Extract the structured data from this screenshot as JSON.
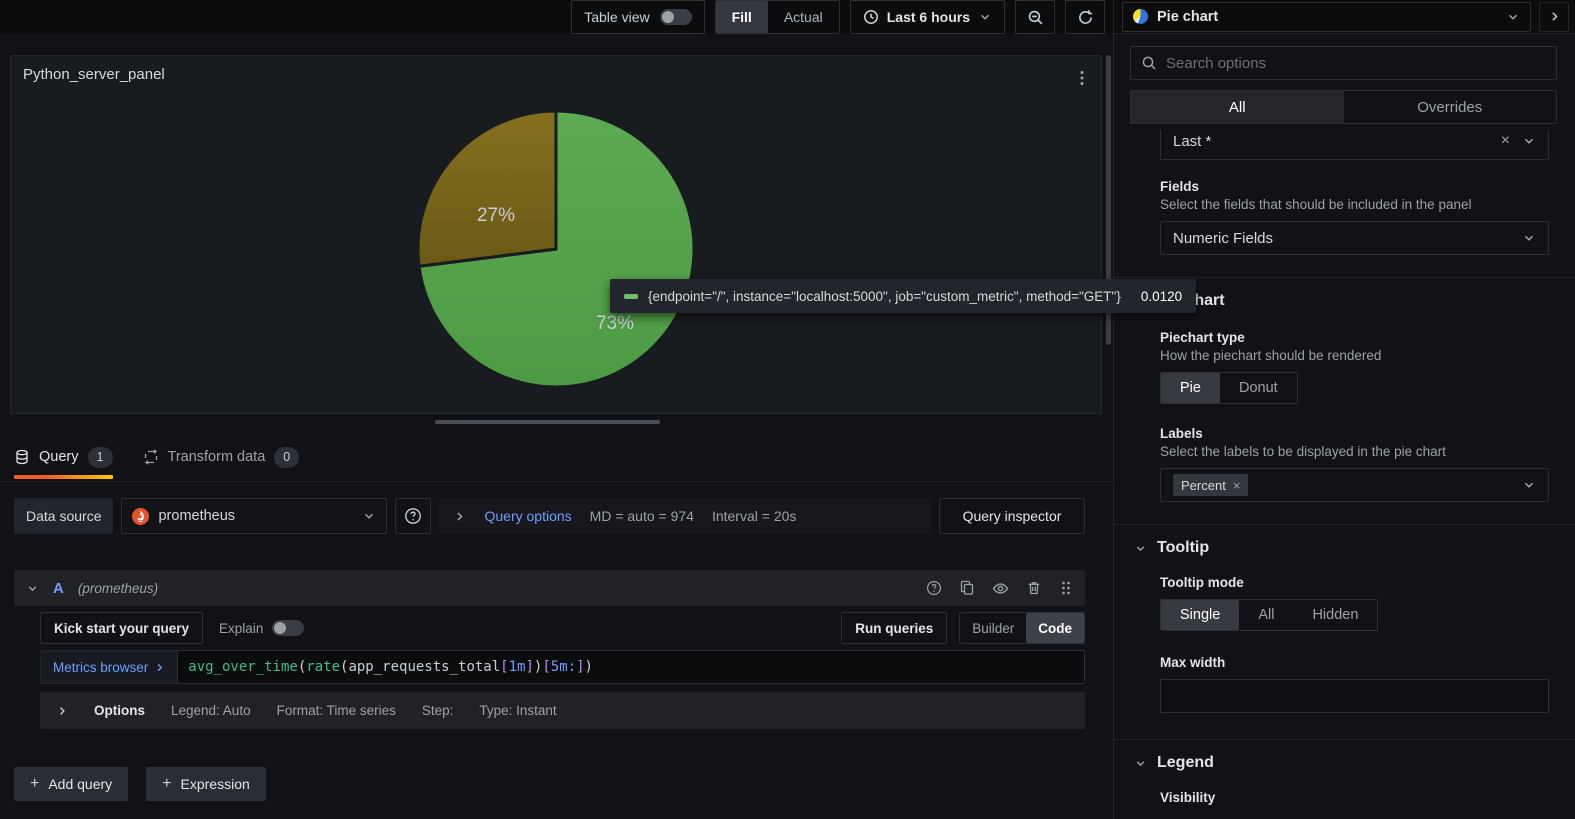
{
  "topbar": {
    "table_view_label": "Table view",
    "fill_label": "Fill",
    "actual_label": "Actual",
    "time_range_label": "Last 6 hours"
  },
  "panel": {
    "title": "Python_server_panel"
  },
  "chart_data": {
    "type": "pie",
    "title": "Python_server_panel",
    "slices": [
      {
        "label": "73%",
        "value": 73,
        "color": "#56a64b",
        "series": "{endpoint=\"/\", instance=\"localhost:5000\", job=\"custom_metric\", method=\"GET\"}",
        "tooltip_value": "0.0120"
      },
      {
        "label": "27%",
        "value": 27,
        "color": "#7d6b1e"
      }
    ],
    "labels_mode": "percent",
    "legend": "off"
  },
  "tooltip": {
    "series": "{endpoint=\"/\", instance=\"localhost:5000\", job=\"custom_metric\", method=\"GET\"}",
    "value": "0.0120",
    "marker_color": "#73bf69"
  },
  "tabs": {
    "query_label": "Query",
    "query_count": "1",
    "transform_label": "Transform data",
    "transform_count": "0"
  },
  "query_toolbar": {
    "datasource_label": "Data source",
    "datasource_value": "prometheus",
    "query_options_label": "Query options",
    "max_data_points": "MD = auto = 974",
    "interval": "Interval = 20s",
    "query_inspector_label": "Query inspector"
  },
  "query_row": {
    "ref_id": "A",
    "datasource_hint": "(prometheus)",
    "kick_start_label": "Kick start your query",
    "explain_label": "Explain",
    "run_queries_label": "Run queries",
    "builder_label": "Builder",
    "code_label": "Code",
    "metrics_browser_label": "Metrics browser",
    "expression_text": "avg_over_time(rate(app_requests_total[1m])[5m:])",
    "expr_tokens": [
      {
        "t": "avg_over_time",
        "c": "fn"
      },
      {
        "t": "(",
        "c": "paren"
      },
      {
        "t": "rate",
        "c": "fn"
      },
      {
        "t": "(",
        "c": "paren"
      },
      {
        "t": "app_requests_total",
        "c": "metric"
      },
      {
        "t": "[",
        "c": "bracket"
      },
      {
        "t": "1m",
        "c": "dur"
      },
      {
        "t": "]",
        "c": "bracket"
      },
      {
        "t": ")",
        "c": "paren"
      },
      {
        "t": "[",
        "c": "bracket"
      },
      {
        "t": "5m:",
        "c": "dur"
      },
      {
        "t": "]",
        "c": "bracket"
      },
      {
        "t": ")",
        "c": "paren"
      }
    ],
    "options_label": "Options",
    "options_legend": "Legend: Auto",
    "options_format": "Format: Time series",
    "options_step": "Step:",
    "options_type": "Type: Instant"
  },
  "footer_buttons": {
    "add_query_label": "Add query",
    "expression_label": "Expression"
  },
  "sidebar": {
    "viz_title": "Pie chart",
    "search_placeholder": "Search options",
    "tab_all": "All",
    "tab_overrides": "Overrides",
    "calculation_value": "Last *",
    "fields_label": "Fields",
    "fields_description": "Select the fields that should be included in the panel",
    "fields_value": "Numeric Fields",
    "pie_section_title": "Pie chart",
    "pie_type_label": "Piechart type",
    "pie_type_description": "How the piechart should be rendered",
    "pie_type_options": [
      "Pie",
      "Donut"
    ],
    "pie_type_selected": "Pie",
    "labels_label": "Labels",
    "labels_description": "Select the labels to be displayed in the pie chart",
    "labels_value": "Percent",
    "tooltip_section_title": "Tooltip",
    "tooltip_mode_label": "Tooltip mode",
    "tooltip_mode_options": [
      "Single",
      "All",
      "Hidden"
    ],
    "tooltip_mode_selected": "Single",
    "max_width_label": "Max width",
    "legend_section_title": "Legend",
    "visibility_label": "Visibility"
  }
}
